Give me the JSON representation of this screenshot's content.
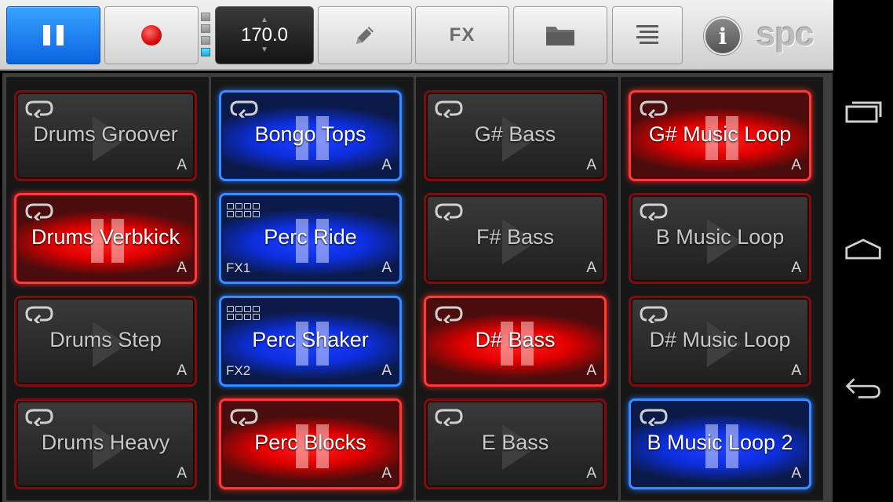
{
  "toolbar": {
    "play_state": "pause",
    "tempo": {
      "value": "170.0"
    },
    "fx_label": "FX",
    "logo_text": "spc",
    "info_symbol": "i",
    "pad_page_indicator": {
      "pages": 4,
      "active_page": 4
    }
  },
  "colors": {
    "active_blue": "#0a63e0",
    "record_red": "#d60c0c",
    "pad_red": "#ff1f1f",
    "pad_blue": "#1e3fff",
    "pad_off_border": "#7a0f10",
    "page_led_on": "#1aa9d6"
  },
  "pads": [
    [
      {
        "name": "Drums Groover",
        "slot": "A",
        "state": "off",
        "icon": "loop-icon"
      },
      {
        "name": "Drums Verbkick",
        "slot": "A",
        "state": "red",
        "icon": "loop-icon"
      },
      {
        "name": "Drums Step",
        "slot": "A",
        "state": "off",
        "icon": "loop-icon"
      },
      {
        "name": "Drums Heavy",
        "slot": "A",
        "state": "off",
        "icon": "loop-icon"
      }
    ],
    [
      {
        "name": "Bongo Tops",
        "slot": "A",
        "state": "blue",
        "icon": "loop-icon"
      },
      {
        "name": "Perc Ride",
        "slot": "A",
        "fx": "FX1",
        "state": "blue",
        "icon": "grid-icon"
      },
      {
        "name": "Perc Shaker",
        "slot": "A",
        "fx": "FX2",
        "state": "blue",
        "icon": "grid-icon"
      },
      {
        "name": "Perc Blocks",
        "slot": "A",
        "state": "red",
        "icon": "loop-icon"
      }
    ],
    [
      {
        "name": "G# Bass",
        "slot": "A",
        "state": "off",
        "icon": "loop-icon"
      },
      {
        "name": "F# Bass",
        "slot": "A",
        "state": "off",
        "icon": "loop-icon"
      },
      {
        "name": "D# Bass",
        "slot": "A",
        "state": "red",
        "icon": "loop-icon"
      },
      {
        "name": "E Bass",
        "slot": "A",
        "state": "off",
        "icon": "loop-icon"
      }
    ],
    [
      {
        "name": "G# Music Loop",
        "slot": "A",
        "state": "red",
        "icon": "loop-icon"
      },
      {
        "name": "B Music Loop",
        "slot": "A",
        "state": "off",
        "icon": "loop-icon"
      },
      {
        "name": "D# Music Loop",
        "slot": "A",
        "state": "off",
        "icon": "loop-icon"
      },
      {
        "name": "B Music Loop 2",
        "slot": "A",
        "state": "blue",
        "icon": "loop-icon"
      }
    ]
  ],
  "navbar": {
    "icons": [
      "recent-apps-icon",
      "home-icon",
      "back-icon"
    ]
  }
}
